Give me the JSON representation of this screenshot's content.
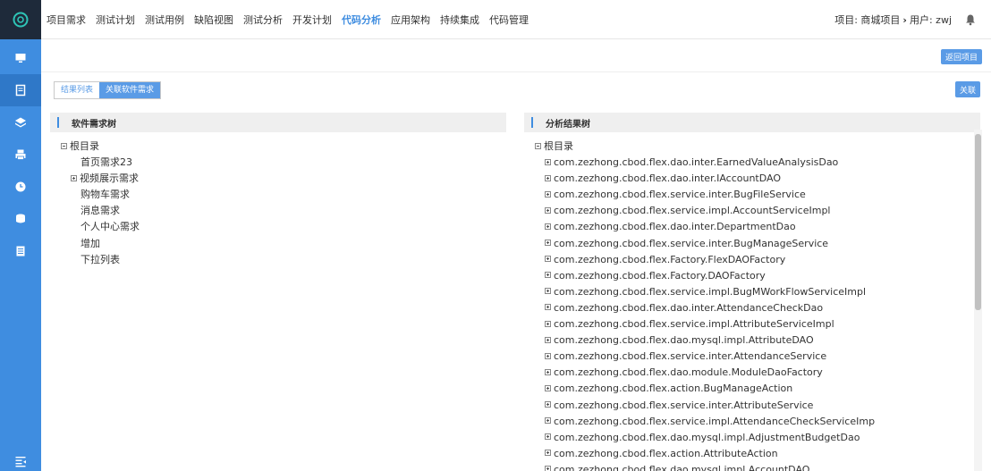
{
  "rail": {
    "items": [
      {
        "icon": "monitor-icon"
      },
      {
        "icon": "document-icon"
      },
      {
        "icon": "layers-icon"
      },
      {
        "icon": "printer-icon"
      },
      {
        "icon": "clock-icon"
      },
      {
        "icon": "database-icon"
      },
      {
        "icon": "list-icon"
      }
    ],
    "bottom_icon": "menu-collapse-icon"
  },
  "topnav": {
    "menu": [
      "项目需求",
      "测试计划",
      "测试用例",
      "缺陷视图",
      "测试分析",
      "开发计划",
      "代码分析",
      "应用架构",
      "持续集成",
      "代码管理"
    ],
    "active": "代码分析",
    "project_label": "项目: 商城项目",
    "arrow": "›",
    "user_label": "用户: zwj"
  },
  "toolbar": {
    "return_button": "返回项目",
    "link_button": "关联"
  },
  "tabs": [
    "结果列表",
    "关联软件需求"
  ],
  "left_panel": {
    "title": "软件需求树",
    "root": "根目录",
    "items": [
      {
        "label": "首页需求23",
        "expandable": false
      },
      {
        "label": "视频展示需求",
        "expandable": true
      },
      {
        "label": "购物车需求",
        "expandable": false
      },
      {
        "label": "消息需求",
        "expandable": false
      },
      {
        "label": "个人中心需求",
        "expandable": false
      },
      {
        "label": "增加",
        "expandable": false
      },
      {
        "label": "下拉列表",
        "expandable": false
      }
    ]
  },
  "right_panel": {
    "title": "分析结果树",
    "root": "根目录",
    "items": [
      "com.zezhong.cbod.flex.dao.inter.EarnedValueAnalysisDao",
      "com.zezhong.cbod.flex.dao.inter.IAccountDAO",
      "com.zezhong.cbod.flex.service.inter.BugFileService",
      "com.zezhong.cbod.flex.service.impl.AccountServiceImpl",
      "com.zezhong.cbod.flex.dao.inter.DepartmentDao",
      "com.zezhong.cbod.flex.service.inter.BugManageService",
      "com.zezhong.cbod.flex.Factory.FlexDAOFactory",
      "com.zezhong.cbod.flex.Factory.DAOFactory",
      "com.zezhong.cbod.flex.service.impl.BugMWorkFlowServiceImpl",
      "com.zezhong.cbod.flex.dao.inter.AttendanceCheckDao",
      "com.zezhong.cbod.flex.service.impl.AttributeServiceImpl",
      "com.zezhong.cbod.flex.dao.mysql.impl.AttributeDAO",
      "com.zezhong.cbod.flex.service.inter.AttendanceService",
      "com.zezhong.cbod.flex.dao.module.ModuleDaoFactory",
      "com.zezhong.cbod.flex.action.BugManageAction",
      "com.zezhong.cbod.flex.service.inter.AttributeService",
      "com.zezhong.cbod.flex.service.impl.AttendanceCheckServiceImp",
      "com.zezhong.cbod.flex.dao.mysql.impl.AdjustmentBudgetDao",
      "com.zezhong.cbod.flex.action.AttributeAction",
      "com.zezhong.cbod.flex.dao.mysql.impl.AccountDAO"
    ]
  },
  "colors": {
    "rail": "#3f8de0",
    "accent": "#3f8de0",
    "button": "#5a9be6"
  }
}
